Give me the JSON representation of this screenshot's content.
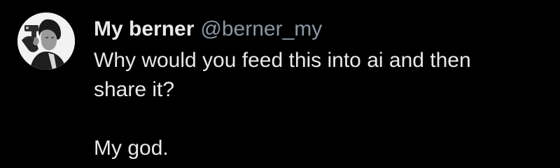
{
  "tweet": {
    "display_name": "My berner",
    "handle": "@berner_my",
    "text_lines": [
      "Why would you feed this into ai and then",
      "share it?",
      "",
      "My god."
    ],
    "avatar_icon": "profile-photo-man-with-pistol",
    "colors": {
      "background": "#000000",
      "name": "#e7e9ea",
      "handle": "#8b98a5",
      "text": "#e7e9ea"
    }
  }
}
